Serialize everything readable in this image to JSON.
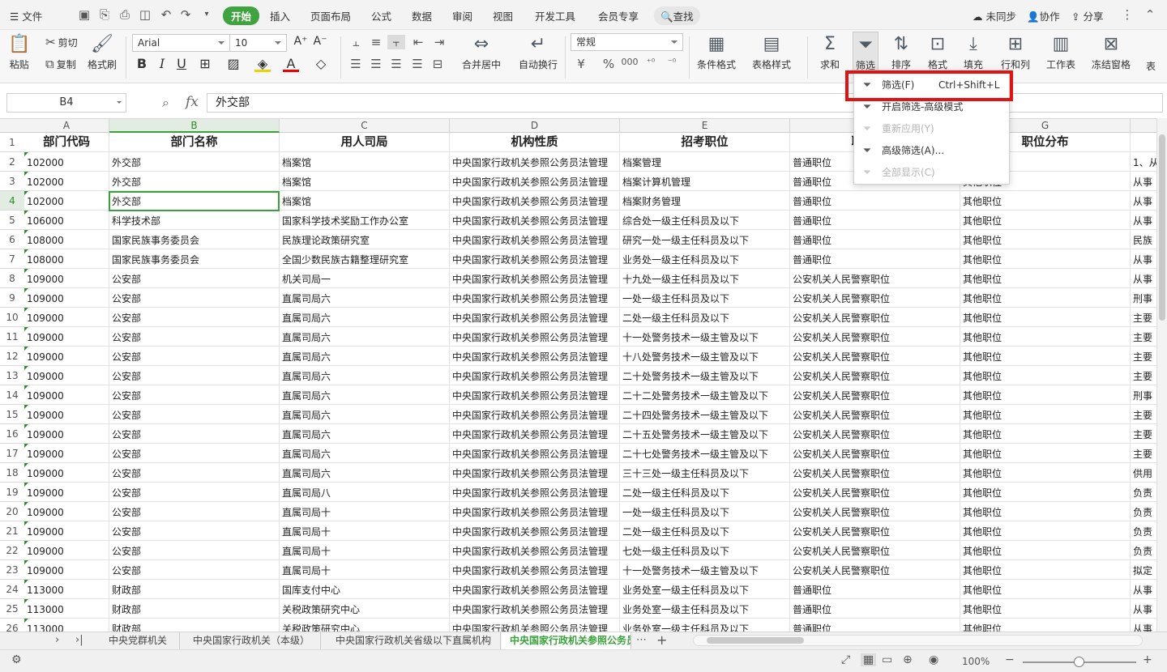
{
  "menubar": {
    "file": "文件",
    "tabs": [
      "开始",
      "插入",
      "页面布局",
      "公式",
      "数据",
      "审阅",
      "视图",
      "开发工具",
      "会员专享"
    ],
    "search": "查找",
    "sync": "未同步",
    "collab": "协作",
    "share": "分享"
  },
  "ribbon": {
    "paste": "粘贴",
    "cut": "剪切",
    "copy": "复制",
    "format_painter": "格式刷",
    "font": "Arial",
    "size": "10",
    "merge": "合并居中",
    "wrap": "自动换行",
    "number_format": "常规",
    "cond_format": "条件格式",
    "table_style": "表格样式",
    "sum": "求和",
    "filter": "筛选",
    "sort": "排序",
    "format": "格式",
    "fill": "填充",
    "rowcol": "行和列",
    "worksheet": "工作表",
    "freeze": "冻结窗格",
    "more": "表"
  },
  "formula_bar": {
    "name_box": "B4",
    "fx": "fx",
    "value": "外交部"
  },
  "columns": [
    "A",
    "B",
    "C",
    "D",
    "E",
    "F",
    "G",
    ""
  ],
  "row_numbers": [
    "1",
    "2",
    "3",
    "4",
    "5",
    "6",
    "7",
    "8",
    "9",
    "10",
    "11",
    "12",
    "13",
    "14",
    "15",
    "16",
    "17",
    "18",
    "19",
    "20",
    "21",
    "22",
    "23",
    "24",
    "25",
    "26"
  ],
  "table": {
    "headers": [
      "部门代码",
      "部门名称",
      "用人司局",
      "机构性质",
      "招考职位",
      "职位属性",
      "职位分布",
      ""
    ],
    "rows": [
      [
        "102000",
        "外交部",
        "档案馆",
        "中央国家行政机关参照公务员法管理",
        "档案管理",
        "普通职位",
        "",
        "1、从"
      ],
      [
        "102000",
        "外交部",
        "档案馆",
        "中央国家行政机关参照公务员法管理",
        "档案计算机管理",
        "普通职位",
        "其他职位",
        "从事"
      ],
      [
        "102000",
        "外交部",
        "档案馆",
        "中央国家行政机关参照公务员法管理",
        "档案财务管理",
        "普通职位",
        "其他职位",
        "从事"
      ],
      [
        "106000",
        "科学技术部",
        "国家科学技术奖励工作办公室",
        "中央国家行政机关参照公务员法管理",
        "综合处一级主任科员及以下",
        "普通职位",
        "其他职位",
        "从事"
      ],
      [
        "108000",
        "国家民族事务委员会",
        "民族理论政策研究室",
        "中央国家行政机关参照公务员法管理",
        "研究一处一级主任科员及以下",
        "普通职位",
        "其他职位",
        "民族"
      ],
      [
        "108000",
        "国家民族事务委员会",
        "全国少数民族古籍整理研究室",
        "中央国家行政机关参照公务员法管理",
        "业务处一级主任科员及以下",
        "普通职位",
        "其他职位",
        "从事"
      ],
      [
        "109000",
        "公安部",
        "机关司局一",
        "中央国家行政机关参照公务员法管理",
        "十九处一级主任科员及以下",
        "公安机关人民警察职位",
        "其他职位",
        "从事"
      ],
      [
        "109000",
        "公安部",
        "直属司局六",
        "中央国家行政机关参照公务员法管理",
        "一处一级主任科员及以下",
        "公安机关人民警察职位",
        "其他职位",
        "刑事"
      ],
      [
        "109000",
        "公安部",
        "直属司局六",
        "中央国家行政机关参照公务员法管理",
        "二处一级主任科员及以下",
        "公安机关人民警察职位",
        "其他职位",
        "主要"
      ],
      [
        "109000",
        "公安部",
        "直属司局六",
        "中央国家行政机关参照公务员法管理",
        "十一处警务技术一级主管及以下",
        "公安机关人民警察职位",
        "其他职位",
        "主要"
      ],
      [
        "109000",
        "公安部",
        "直属司局六",
        "中央国家行政机关参照公务员法管理",
        "十八处警务技术一级主管及以下",
        "公安机关人民警察职位",
        "其他职位",
        "主要"
      ],
      [
        "109000",
        "公安部",
        "直属司局六",
        "中央国家行政机关参照公务员法管理",
        "二十处警务技术一级主管及以下",
        "公安机关人民警察职位",
        "其他职位",
        "主要"
      ],
      [
        "109000",
        "公安部",
        "直属司局六",
        "中央国家行政机关参照公务员法管理",
        "二十二处警务技术一级主管及以下",
        "公安机关人民警察职位",
        "其他职位",
        "刑事"
      ],
      [
        "109000",
        "公安部",
        "直属司局六",
        "中央国家行政机关参照公务员法管理",
        "二十四处警务技术一级主管及以下",
        "公安机关人民警察职位",
        "其他职位",
        "主要"
      ],
      [
        "109000",
        "公安部",
        "直属司局六",
        "中央国家行政机关参照公务员法管理",
        "二十五处警务技术一级主管及以下",
        "公安机关人民警察职位",
        "其他职位",
        "主要"
      ],
      [
        "109000",
        "公安部",
        "直属司局六",
        "中央国家行政机关参照公务员法管理",
        "二十七处警务技术一级主管及以下",
        "公安机关人民警察职位",
        "其他职位",
        "主要"
      ],
      [
        "109000",
        "公安部",
        "直属司局六",
        "中央国家行政机关参照公务员法管理",
        "三十三处一级主任科员及以下",
        "公安机关人民警察职位",
        "其他职位",
        "供用"
      ],
      [
        "109000",
        "公安部",
        "直属司局八",
        "中央国家行政机关参照公务员法管理",
        "二处一级主任科员及以下",
        "公安机关人民警察职位",
        "其他职位",
        "负责"
      ],
      [
        "109000",
        "公安部",
        "直属司局十",
        "中央国家行政机关参照公务员法管理",
        "一处一级主任科员及以下",
        "公安机关人民警察职位",
        "其他职位",
        "负责"
      ],
      [
        "109000",
        "公安部",
        "直属司局十",
        "中央国家行政机关参照公务员法管理",
        "二处一级主任科员及以下",
        "公安机关人民警察职位",
        "其他职位",
        "负责"
      ],
      [
        "109000",
        "公安部",
        "直属司局十",
        "中央国家行政机关参照公务员法管理",
        "七处一级主任科员及以下",
        "公安机关人民警察职位",
        "其他职位",
        "负责"
      ],
      [
        "109000",
        "公安部",
        "直属司局十",
        "中央国家行政机关参照公务员法管理",
        "十一处警务技术一级主管及以下",
        "公安机关人民警察职位",
        "其他职位",
        "拟定"
      ],
      [
        "113000",
        "财政部",
        "国库支付中心",
        "中央国家行政机关参照公务员法管理",
        "业务处室一级主任科员及以下",
        "普通职位",
        "其他职位",
        "从事"
      ],
      [
        "113000",
        "财政部",
        "关税政策研究中心",
        "中央国家行政机关参照公务员法管理",
        "业务处室一级主任科员及以下",
        "普通职位",
        "其他职位",
        "从事"
      ],
      [
        "113000",
        "财政部",
        "关税政策研究中心",
        "中央国家行政机关参照公务员法管理",
        "业务处室一级主任科员及以下",
        "普通职位",
        "其他职位",
        "从事"
      ]
    ]
  },
  "sheets": [
    "中央党群机关",
    "中央国家行政机关（本级）",
    "中央国家行政机关省级以下直属机构",
    "中央国家行政机关参照公务员"
  ],
  "status": {
    "zoom": "100%"
  },
  "filter_menu": [
    {
      "label": "筛选(F)",
      "shortcut": "Ctrl+Shift+L",
      "enabled": true
    },
    {
      "label": "开启筛选-高级模式",
      "shortcut": "",
      "enabled": true
    },
    {
      "label": "重新应用(Y)",
      "shortcut": "",
      "enabled": false
    },
    {
      "label": "高级筛选(A)...",
      "shortcut": "",
      "enabled": true
    },
    {
      "label": "全部显示(C)",
      "shortcut": "",
      "enabled": false
    }
  ],
  "colors": {
    "accent": "#3fa33f",
    "highlight": "#e21212"
  }
}
